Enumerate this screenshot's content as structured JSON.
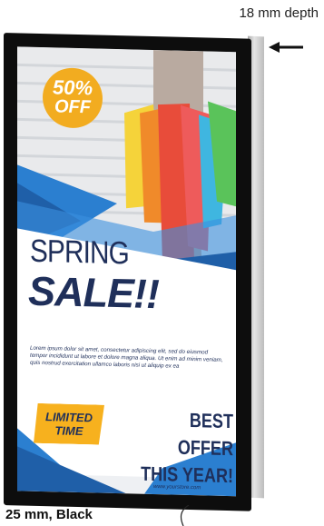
{
  "depth_label": "18 mm depth",
  "frame_label": "25 mm, Black",
  "poster": {
    "badge_percent": "50%",
    "badge_off": "OFF",
    "headline_1": "SPRING",
    "headline_2": "SALE!!",
    "body_text": "Lorem ipsum dolor sit amet, consectetur adipiscing elit, sed do eiusmod tempor incididunt ut labore et dolore magna aliqua. Ut enim ad minim veniam, quis nostrud exercitation ullamco laboris nisi ut aliquip ex ea",
    "tag_line_1": "LIMITED",
    "tag_line_2": "TIME",
    "offer_line_1": "BEST OFFER",
    "offer_line_2": "THIS YEAR!",
    "url": "www.yourstore.com"
  },
  "colors": {
    "frame": "#0d0d0d",
    "navy": "#1f2f5a",
    "accent_blue": "#2b7fd0",
    "yellow": "#f2ac20"
  }
}
